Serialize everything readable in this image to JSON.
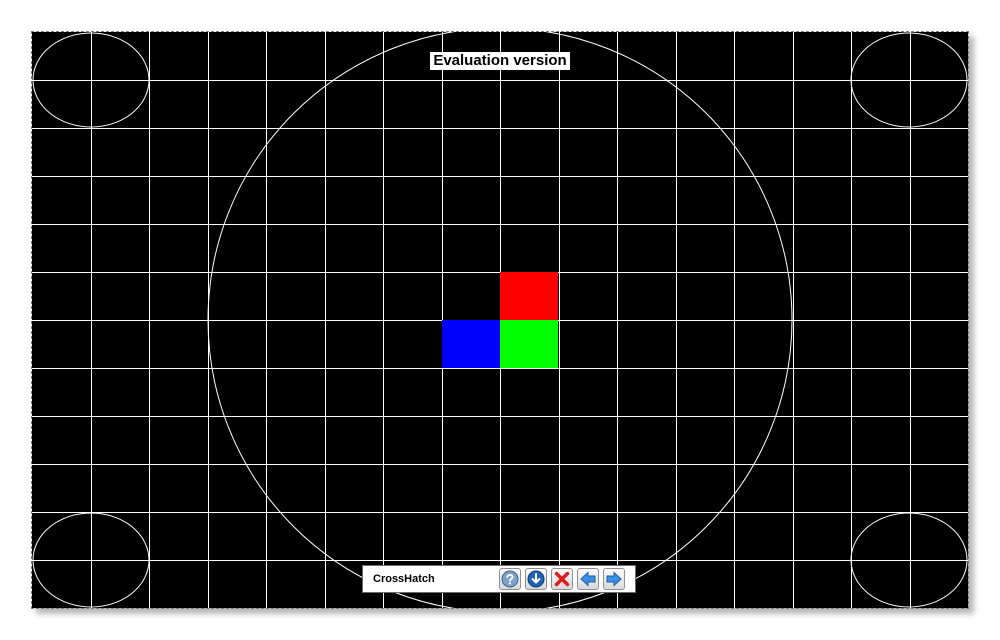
{
  "overlay": {
    "evaluation_label": "Evaluation version"
  },
  "pattern": {
    "name": "CrossHatch",
    "background_color": "#000000",
    "line_color": "#ffffff",
    "patches": [
      {
        "name": "red-patch",
        "color": "#ff0000"
      },
      {
        "name": "blue-patch",
        "color": "#0000ff"
      },
      {
        "name": "green-patch",
        "color": "#00ff00"
      }
    ]
  },
  "toolbar": {
    "buttons": [
      {
        "name": "help-button",
        "icon": "question-icon",
        "label": "Help"
      },
      {
        "name": "next-pattern-down-button",
        "icon": "arrow-down-icon",
        "label": "Down"
      },
      {
        "name": "close-button",
        "icon": "close-icon",
        "label": "Close"
      },
      {
        "name": "previous-button",
        "icon": "arrow-left-icon",
        "label": "Previous"
      },
      {
        "name": "next-button",
        "icon": "arrow-right-icon",
        "label": "Next"
      }
    ]
  }
}
